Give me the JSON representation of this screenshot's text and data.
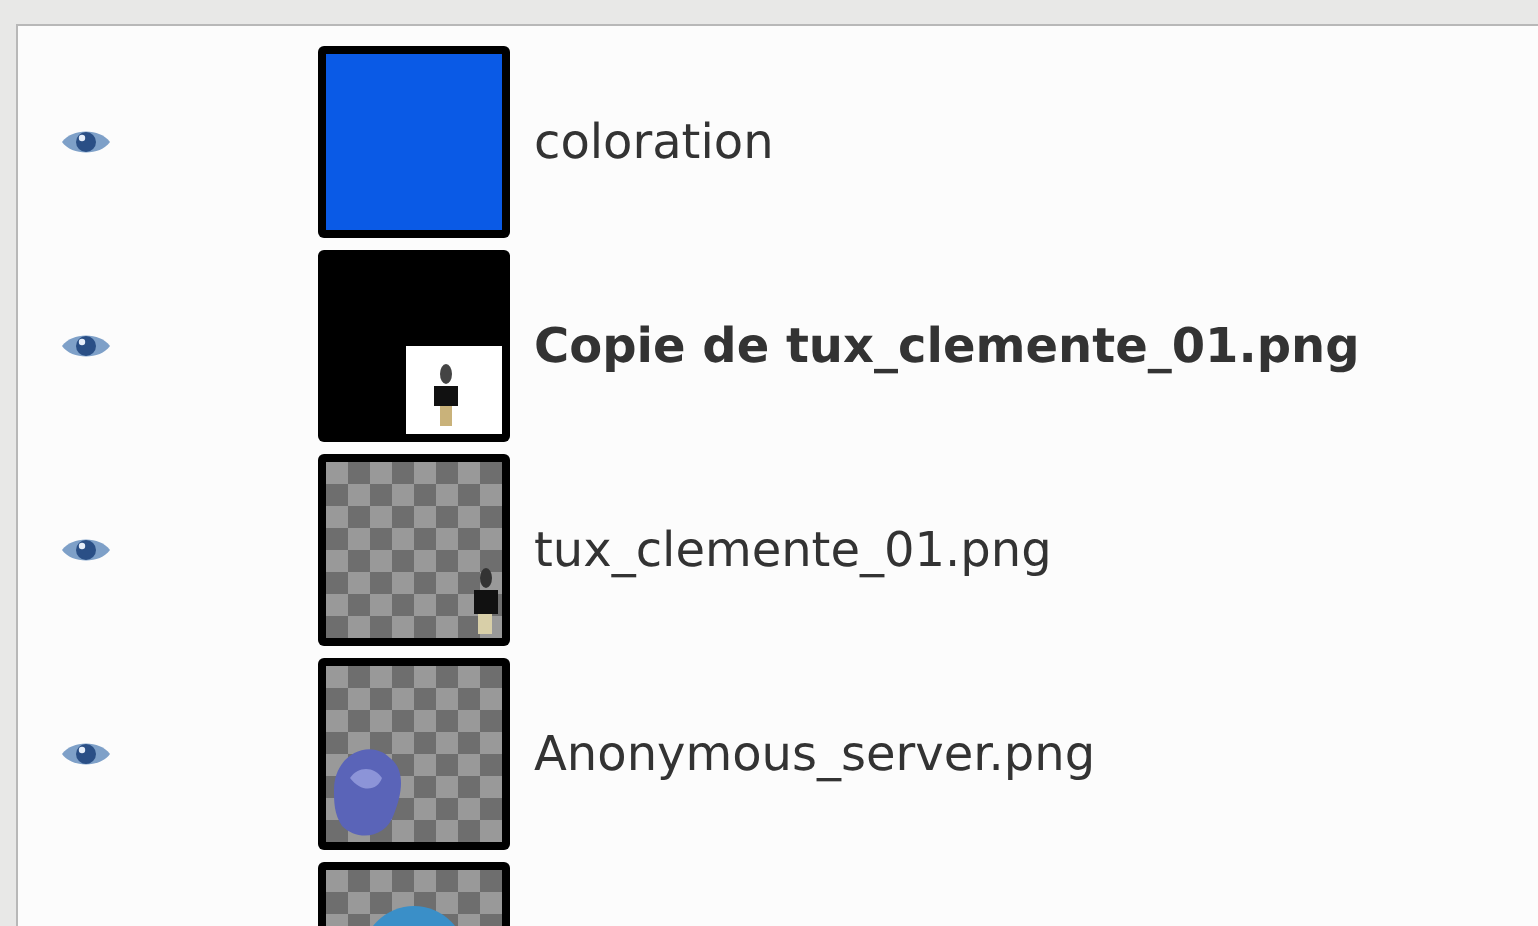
{
  "layers": [
    {
      "name": "coloration",
      "visible": true,
      "alpha_channel": true,
      "thumbnail": {
        "kind": "solid",
        "color": "#0a5ae6"
      }
    },
    {
      "name": "Copie de tux_clemente_01.png",
      "visible": true,
      "alpha_channel": false,
      "thumbnail": {
        "kind": "framed-figure"
      }
    },
    {
      "name": "tux_clemente_01.png",
      "visible": true,
      "alpha_channel": true,
      "thumbnail": {
        "kind": "figure"
      }
    },
    {
      "name": "Anonymous_server.png",
      "visible": true,
      "alpha_channel": true,
      "thumbnail": {
        "kind": "blob"
      }
    },
    {
      "thumbnail": {
        "kind": "globe"
      }
    }
  ]
}
